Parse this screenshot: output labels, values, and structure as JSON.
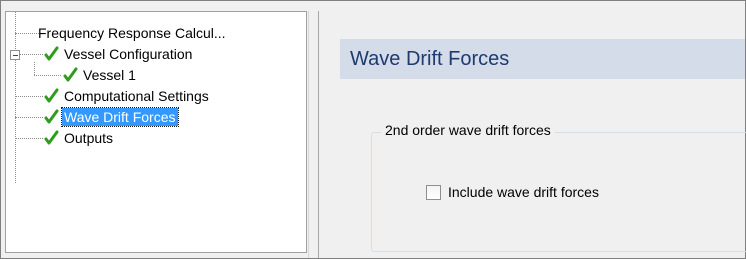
{
  "tree": {
    "items": [
      {
        "label": "Frequency Response Calcul...",
        "checked": false,
        "selected": false,
        "expanded": null
      },
      {
        "label": "Vessel Configuration",
        "checked": true,
        "selected": false,
        "expanded": true
      },
      {
        "label": "Vessel 1",
        "checked": true,
        "selected": false,
        "expanded": null
      },
      {
        "label": "Computational Settings",
        "checked": true,
        "selected": false,
        "expanded": null
      },
      {
        "label": "Wave Drift Forces",
        "checked": true,
        "selected": true,
        "expanded": null
      },
      {
        "label": "Outputs",
        "checked": true,
        "selected": false,
        "expanded": null
      }
    ],
    "check_icon": "green-checkmark-icon",
    "check_color": "#2f9c1e",
    "selection_color": "#3399ff"
  },
  "page": {
    "title": "Wave Drift Forces",
    "header_band_color": "#d4dcea",
    "title_color": "#1e3a6e"
  },
  "group": {
    "legend": "2nd order wave drift forces",
    "checkbox": {
      "label": "Include wave drift forces",
      "checked": false
    }
  }
}
